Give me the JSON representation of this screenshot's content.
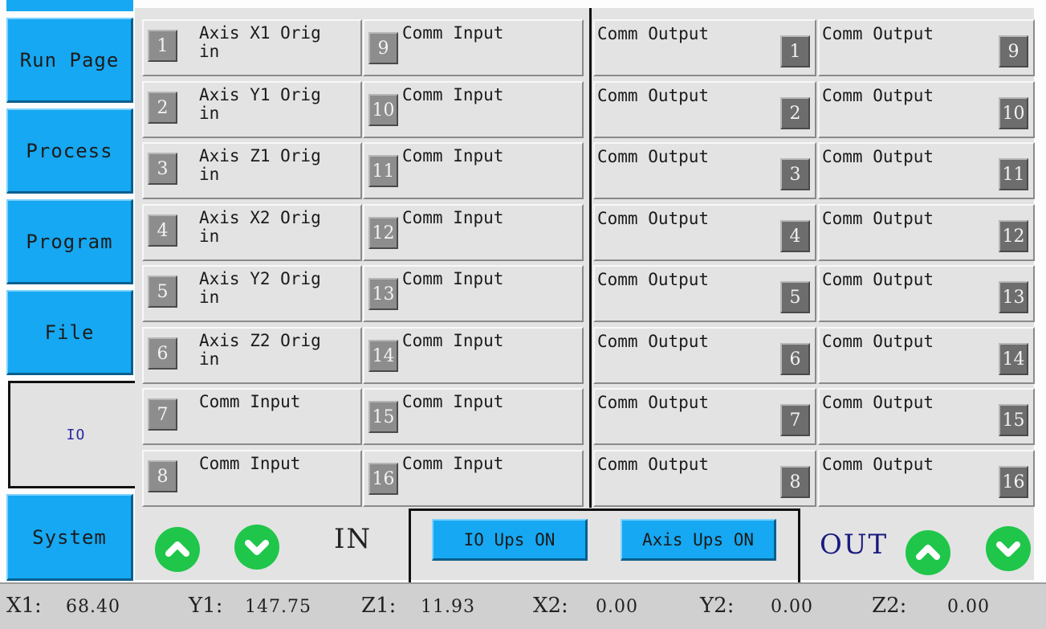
{
  "nav": {
    "run_page": "Run Page",
    "process": "Process",
    "program": "Program",
    "file": "File",
    "io": "IO",
    "system": "System"
  },
  "inputs": {
    "col1": [
      {
        "num": "1",
        "label": "Axis X1 Orig\nin"
      },
      {
        "num": "2",
        "label": "Axis Y1 Orig\nin"
      },
      {
        "num": "3",
        "label": "Axis Z1 Orig\nin"
      },
      {
        "num": "4",
        "label": "Axis X2 Orig\nin"
      },
      {
        "num": "5",
        "label": "Axis Y2 Orig\nin"
      },
      {
        "num": "6",
        "label": "Axis Z2 Orig\nin"
      },
      {
        "num": "7",
        "label": "Comm Input"
      },
      {
        "num": "8",
        "label": "Comm Input"
      }
    ],
    "col2": [
      {
        "num": "9",
        "label": "Comm Input"
      },
      {
        "num": "10",
        "label": "Comm Input"
      },
      {
        "num": "11",
        "label": "Comm Input"
      },
      {
        "num": "12",
        "label": "Comm Input"
      },
      {
        "num": "13",
        "label": "Comm Input"
      },
      {
        "num": "14",
        "label": "Comm Input"
      },
      {
        "num": "15",
        "label": "Comm Input"
      },
      {
        "num": "16",
        "label": "Comm Input"
      }
    ]
  },
  "outputs": {
    "col1": [
      {
        "num": "1",
        "label": "Comm Output"
      },
      {
        "num": "2",
        "label": "Comm Output"
      },
      {
        "num": "3",
        "label": "Comm Output"
      },
      {
        "num": "4",
        "label": "Comm Output"
      },
      {
        "num": "5",
        "label": "Comm Output"
      },
      {
        "num": "6",
        "label": "Comm Output"
      },
      {
        "num": "7",
        "label": "Comm Output"
      },
      {
        "num": "8",
        "label": "Comm Output"
      }
    ],
    "col2": [
      {
        "num": "9",
        "label": "Comm Output"
      },
      {
        "num": "10",
        "label": "Comm Output"
      },
      {
        "num": "11",
        "label": "Comm Output"
      },
      {
        "num": "12",
        "label": "Comm Output"
      },
      {
        "num": "13",
        "label": "Comm Output"
      },
      {
        "num": "14",
        "label": "Comm Output"
      },
      {
        "num": "15",
        "label": "Comm Output"
      },
      {
        "num": "16",
        "label": "Comm Output"
      }
    ]
  },
  "controls": {
    "in_label": "IN",
    "out_label": "OUT",
    "io_ups": "IO Ups ON",
    "axis_ups": "Axis Ups ON",
    "icons": {
      "up": "chevron-up-icon",
      "down": "chevron-down-icon"
    }
  },
  "status": {
    "x1": {
      "key": "X1:",
      "value": "68.40"
    },
    "y1": {
      "key": "Y1:",
      "value": "147.75"
    },
    "z1": {
      "key": "Z1:",
      "value": "11.93"
    },
    "x2": {
      "key": "X2:",
      "value": "0.00"
    },
    "y2": {
      "key": "Y2:",
      "value": "0.00"
    },
    "z2": {
      "key": "Z2:",
      "value": "0.00"
    }
  },
  "colors": {
    "button_blue": "#16a8f2",
    "arrow_green": "#1fc64a",
    "panel_gray": "#e3e3e3",
    "label_navy": "#1a1a80"
  }
}
